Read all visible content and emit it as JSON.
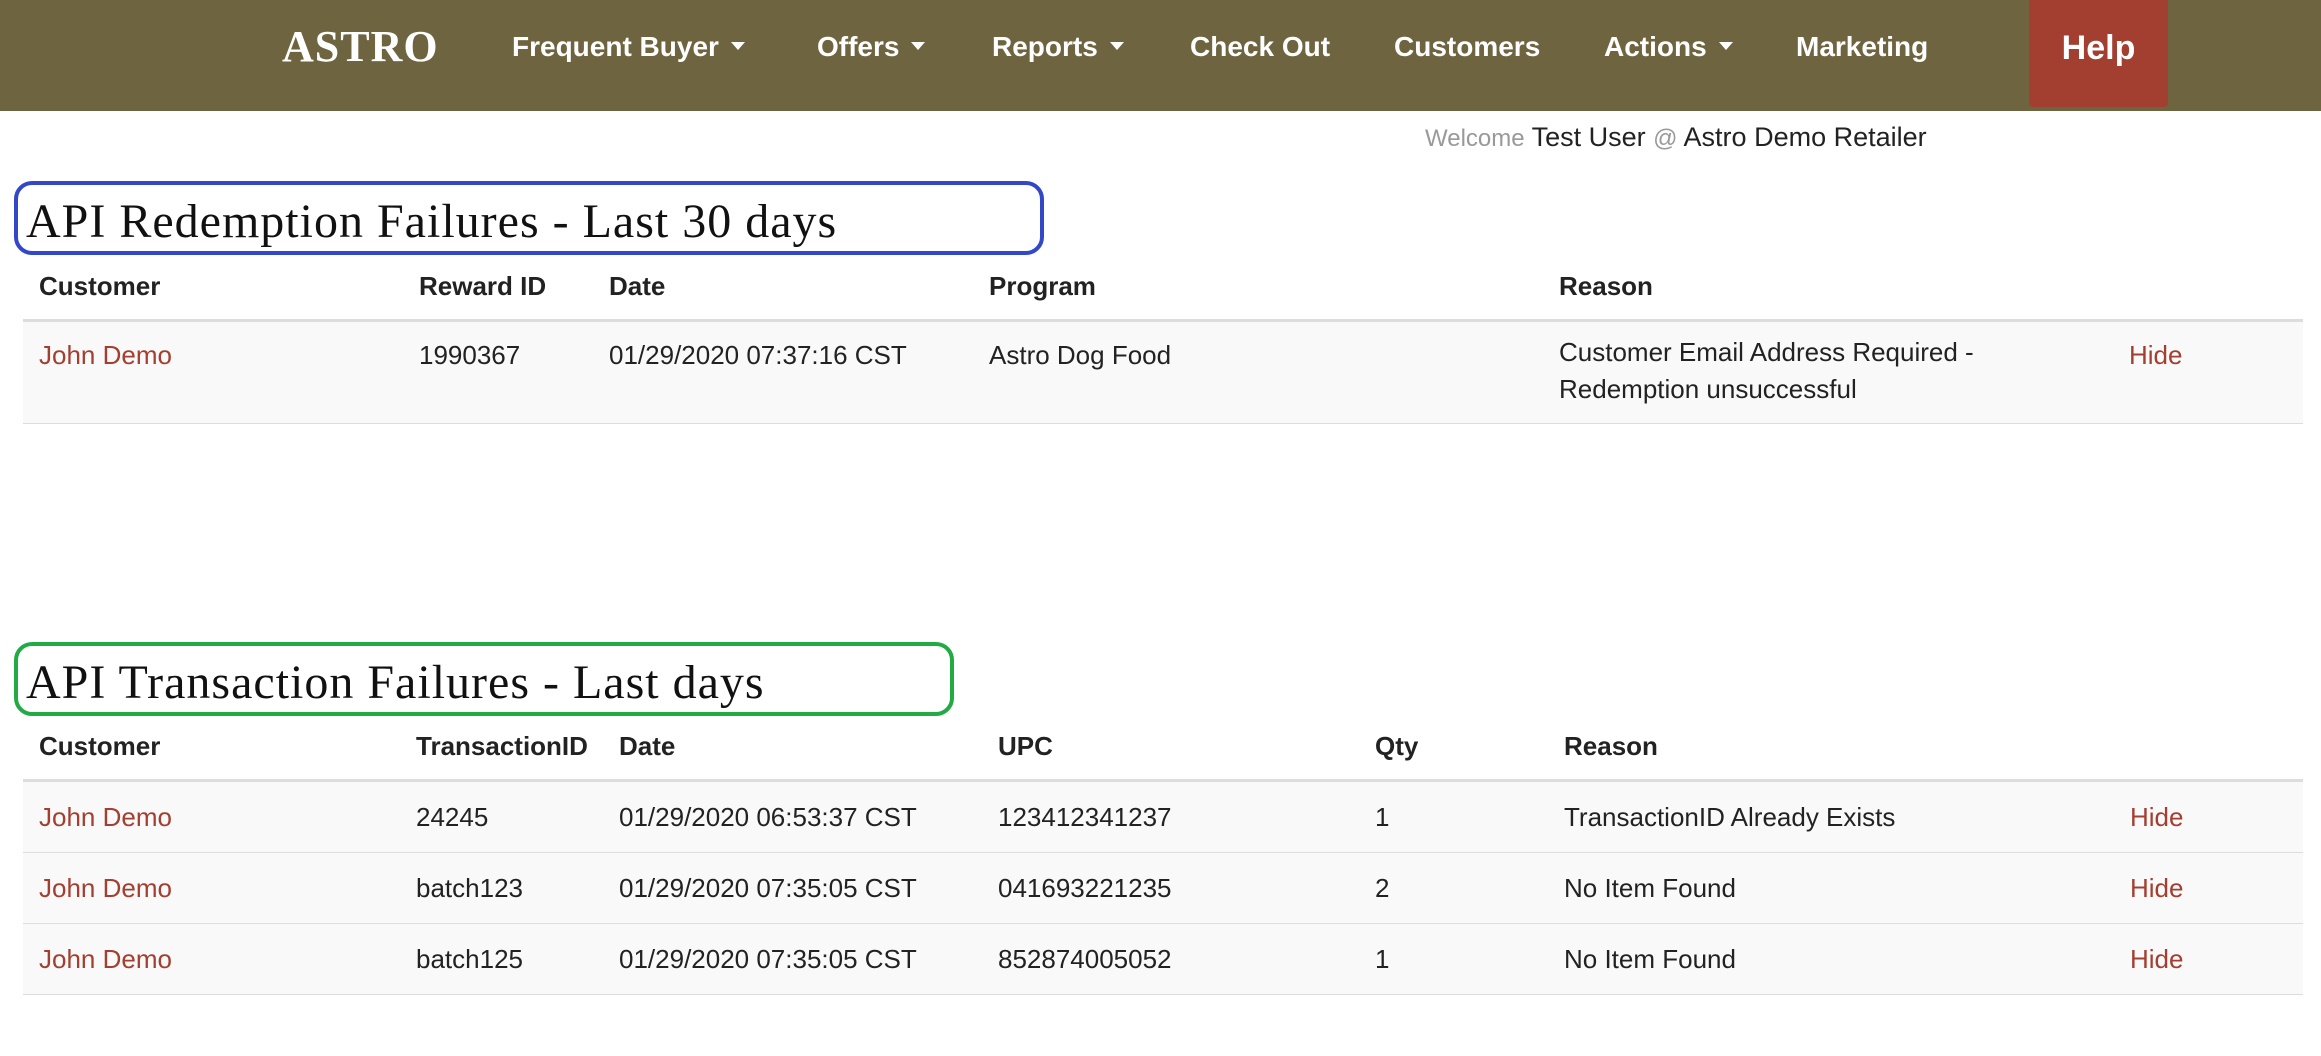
{
  "nav": {
    "brand": "ASTRO",
    "items": [
      {
        "label": "Frequent Buyer",
        "dropdown": true
      },
      {
        "label": "Offers",
        "dropdown": true
      },
      {
        "label": "Reports",
        "dropdown": true
      },
      {
        "label": "Check Out",
        "dropdown": false
      },
      {
        "label": "Customers",
        "dropdown": false
      },
      {
        "label": "Actions",
        "dropdown": true
      },
      {
        "label": "Marketing",
        "dropdown": false
      }
    ],
    "help": "Help",
    "colors": {
      "bar": "#6f6440",
      "help": "#a33f30"
    }
  },
  "welcome": {
    "prefix": "Welcome",
    "user": "Test User",
    "at": "@",
    "retailer": "Astro Demo Retailer"
  },
  "redemption": {
    "title": "API Redemption Failures - Last 30 days",
    "headers": {
      "customer": "Customer",
      "reward_id": "Reward ID",
      "date": "Date",
      "program": "Program",
      "reason": "Reason"
    },
    "rows": [
      {
        "customer": "John Demo",
        "reward_id": "1990367",
        "date": "01/29/2020 07:37:16 CST",
        "program": "Astro Dog Food",
        "reason": "Customer Email Address Required - Redemption unsuccessful",
        "action": "Hide"
      }
    ]
  },
  "transaction": {
    "title": "API Transaction Failures - Last days",
    "headers": {
      "customer": "Customer",
      "transaction_id": "TransactionID",
      "date": "Date",
      "upc": "UPC",
      "qty": "Qty",
      "reason": "Reason"
    },
    "rows": [
      {
        "customer": "John Demo",
        "transaction_id": "24245",
        "date": "01/29/2020 06:53:37 CST",
        "upc": "123412341237",
        "qty": "1",
        "reason": "TransactionID Already Exists",
        "action": "Hide"
      },
      {
        "customer": "John Demo",
        "transaction_id": "batch123",
        "date": "01/29/2020 07:35:05 CST",
        "upc": "041693221235",
        "qty": "2",
        "reason": "No Item Found",
        "action": "Hide"
      },
      {
        "customer": "John Demo",
        "transaction_id": "batch125",
        "date": "01/29/2020 07:35:05 CST",
        "upc": "852874005052",
        "qty": "1",
        "reason": "No Item Found",
        "action": "Hide"
      }
    ]
  },
  "link_color": "#a33f30"
}
